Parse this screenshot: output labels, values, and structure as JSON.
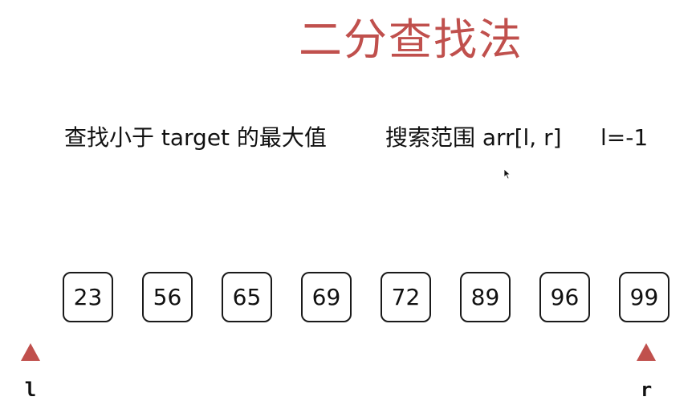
{
  "title": "二分查找法",
  "description": {
    "goal": "查找小于 target 的最大值",
    "range": "搜索范围 arr[l, r]",
    "init": "l=-1"
  },
  "array": [
    "23",
    "56",
    "65",
    "69",
    "72",
    "89",
    "96",
    "99"
  ],
  "pointers": {
    "left": {
      "label": "l"
    },
    "right": {
      "label": "r"
    }
  },
  "colors": {
    "accent": "#c0504d",
    "text": "#111111",
    "border": "#1a1a1a"
  }
}
